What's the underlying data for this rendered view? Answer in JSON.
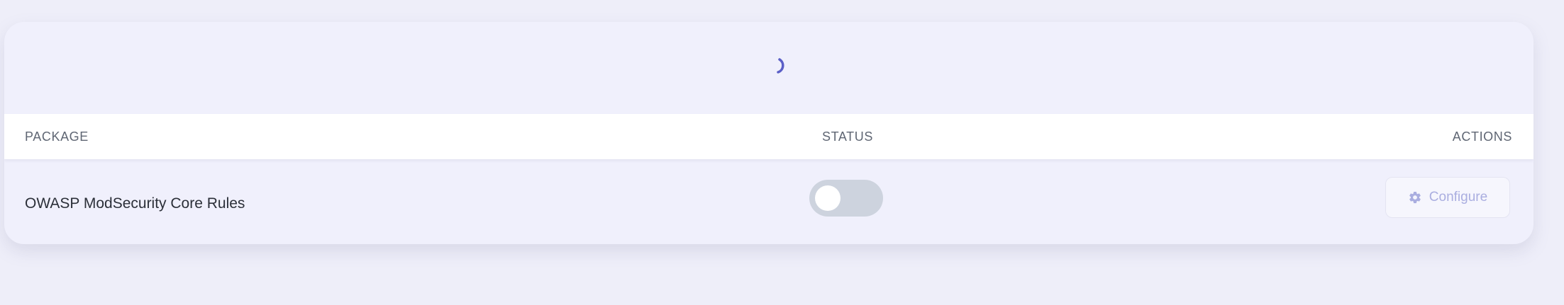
{
  "loader": {
    "icon": "spinner-icon",
    "color": "#5b5fc7"
  },
  "table": {
    "headers": {
      "package": "PACKAGE",
      "status": "STATUS",
      "actions": "ACTIONS"
    },
    "rows": [
      {
        "package": "OWASP ModSecurity Core Rules",
        "status_enabled": false,
        "action_label": "Configure",
        "action_icon": "gear-icon"
      }
    ]
  }
}
